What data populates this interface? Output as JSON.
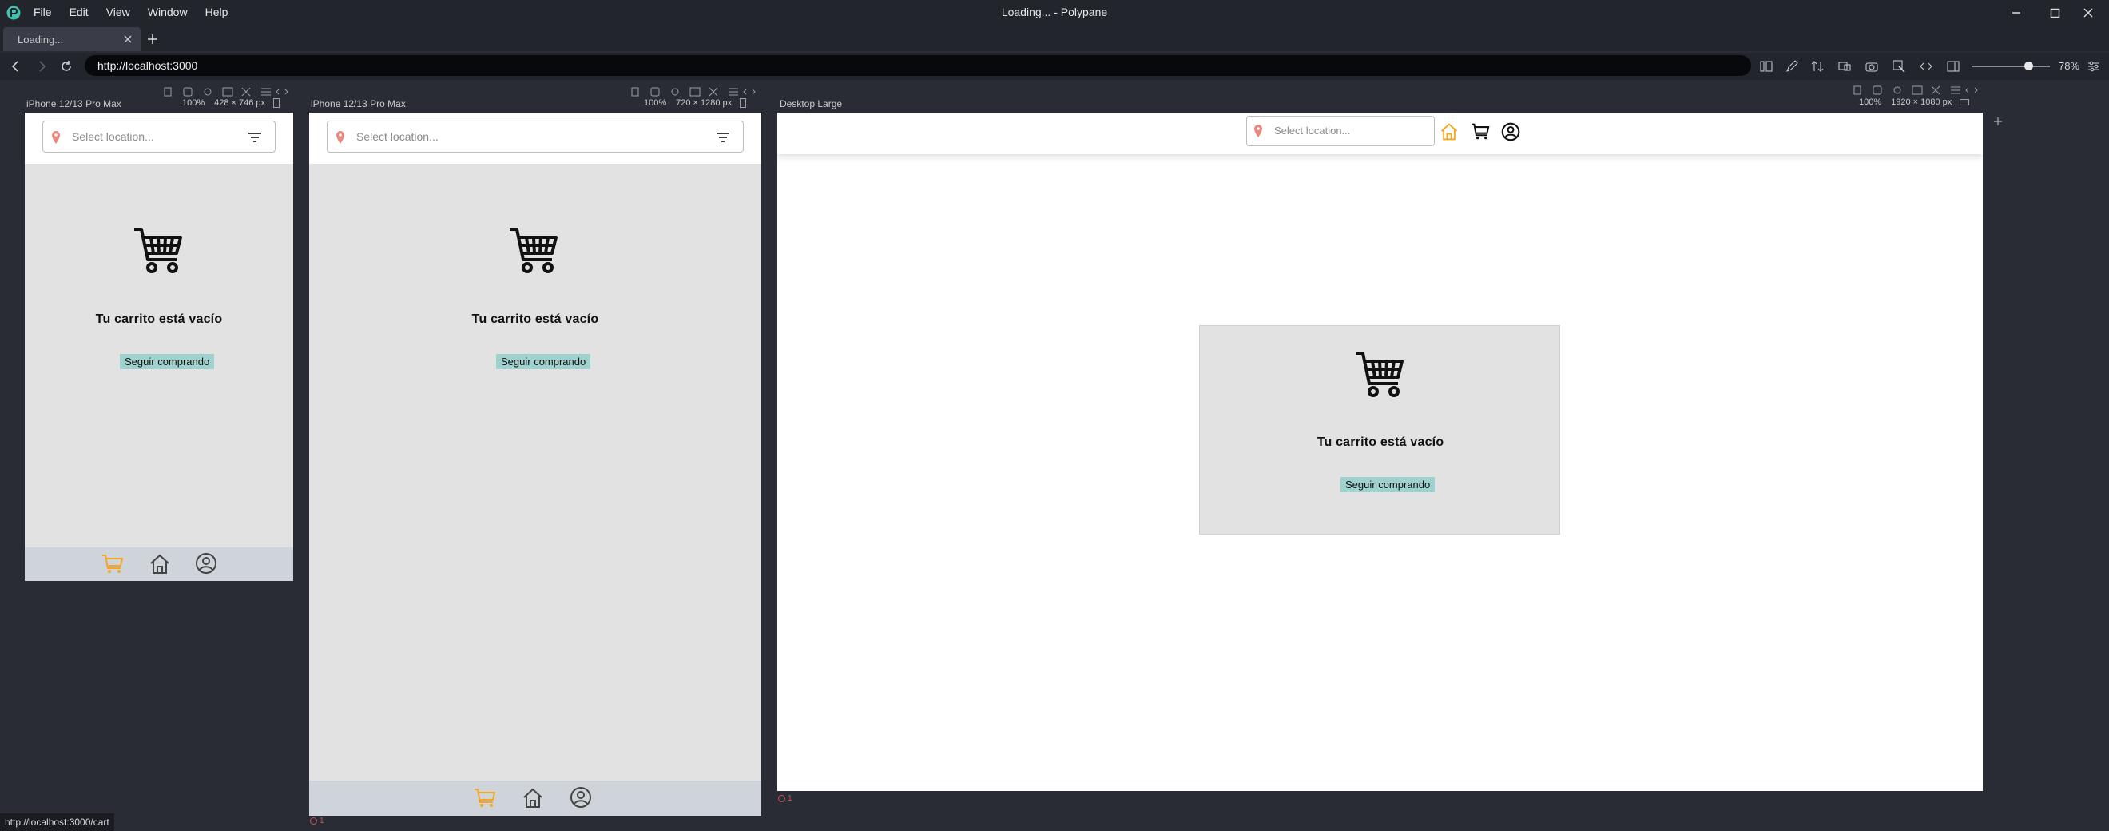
{
  "app": {
    "menu": [
      "File",
      "Edit",
      "View",
      "Window",
      "Help"
    ],
    "title": "Loading... - Polypane",
    "tab_label": "Loading...",
    "url": "http://localhost:3000",
    "zoom": "78%",
    "status_url": "http://localhost:3000/cart",
    "error_count": "1"
  },
  "panes": [
    {
      "name": "iPhone 12/13 Pro Max",
      "zoom": "100%",
      "size": "428 × 746",
      "unit": "px"
    },
    {
      "name": "iPhone 12/13 Pro Max",
      "zoom": "100%",
      "size": "720 × 1280",
      "unit": "px"
    },
    {
      "name": "Desktop Large",
      "zoom": "100%",
      "size": "1920 × 1080",
      "unit": "px"
    }
  ],
  "page": {
    "search_placeholder": "Select location...",
    "empty_title": "Tu carrito está vacío",
    "continue_label": "Seguir comprando"
  },
  "colors": {
    "accent_orange": "#f5a623",
    "button_teal": "#9fd2cf",
    "pin_red": "#e8887f"
  }
}
